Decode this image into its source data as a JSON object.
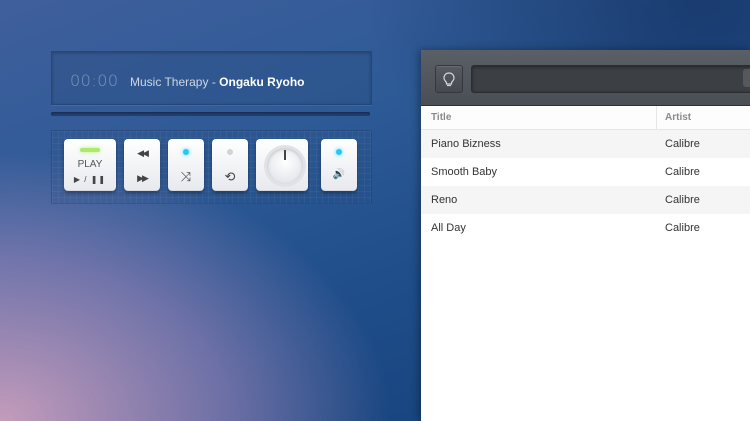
{
  "player": {
    "time": "00:00",
    "track_title": "Music Therapy",
    "track_separator": " - ",
    "track_artist": "Ongaku Ryoho",
    "progress": 0,
    "play_label": "PLAY",
    "play_pause_icons": "▶ / ❚❚",
    "prev_icon": "◀◀",
    "next_icon": "▶▶",
    "shuffle_icon": "⤨",
    "repeat_icon": "⟲",
    "volume_icon": "🔊",
    "shuffle_on": true,
    "repeat_on": false,
    "volume_on": true,
    "led_color_on": "#27c8f0",
    "play_led_color": "#aee86f"
  },
  "window": {
    "toolbar": {
      "bulb_icon": "lightbulb-icon",
      "search_value": "",
      "search_placeholder": ""
    },
    "table": {
      "columns": [
        "Title",
        "Artist"
      ],
      "rows": [
        {
          "title": "Piano Bizness",
          "artist": "Calibre"
        },
        {
          "title": "Smooth Baby",
          "artist": "Calibre"
        },
        {
          "title": "Reno",
          "artist": "Calibre"
        },
        {
          "title": "All Day",
          "artist": "Calibre"
        }
      ]
    }
  }
}
